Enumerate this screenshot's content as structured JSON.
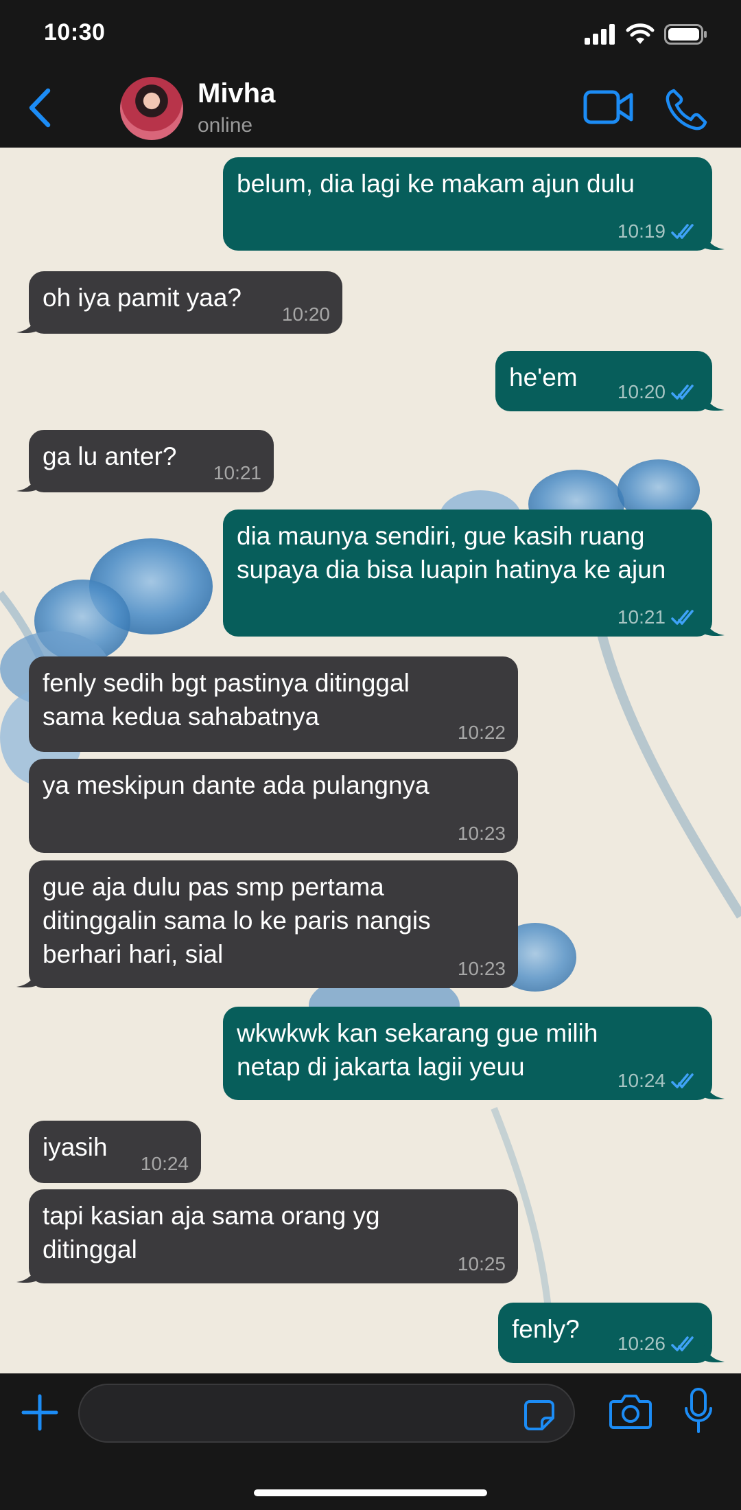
{
  "status_bar": {
    "time": "10:30"
  },
  "header": {
    "contact_name": "Mivha",
    "contact_status": "online",
    "icons": [
      "back-chevron-icon",
      "video-call-icon",
      "phone-call-icon"
    ]
  },
  "colors": {
    "accent": "#1c8cf5",
    "outgoing_bubble": "#075e5b",
    "incoming_bubble": "#3b3a3d",
    "wallpaper": "#efeadf",
    "bar_background": "#171717"
  },
  "messages": [
    {
      "dir": "out",
      "text": "belum, dia lagi ke makam ajun dulu",
      "time": "10:19",
      "read": true
    },
    {
      "dir": "in",
      "text": "oh iya pamit yaa?",
      "time": "10:20"
    },
    {
      "dir": "out",
      "text": "he'em",
      "time": "10:20",
      "read": true
    },
    {
      "dir": "in",
      "text": "ga lu anter?",
      "time": "10:21"
    },
    {
      "dir": "out",
      "text": "dia maunya sendiri, gue kasih ruang supaya dia bisa luapin hatinya ke ajun",
      "time": "10:21",
      "read": true
    },
    {
      "dir": "in",
      "text": "fenly sedih bgt pastinya ditinggal sama kedua sahabatnya",
      "time": "10:22"
    },
    {
      "dir": "in",
      "text": "ya meskipun dante ada pulangnya",
      "time": "10:23"
    },
    {
      "dir": "in",
      "text": "gue aja dulu pas smp pertama ditinggalin sama lo ke paris nangis berhari hari, sial",
      "time": "10:23"
    },
    {
      "dir": "out",
      "text": "wkwkwk kan sekarang gue milih netap di jakarta lagii yeuu",
      "time": "10:24",
      "read": true
    },
    {
      "dir": "in",
      "text": "iyasih",
      "time": "10:24"
    },
    {
      "dir": "in",
      "text": "tapi kasian aja sama orang yg ditinggal",
      "time": "10:25"
    },
    {
      "dir": "out",
      "text": "fenly?",
      "time": "10:26",
      "read": true
    }
  ],
  "input_bar": {
    "message_value": "",
    "icons": [
      "plus-icon",
      "sticker-icon",
      "camera-icon",
      "microphone-icon"
    ]
  }
}
